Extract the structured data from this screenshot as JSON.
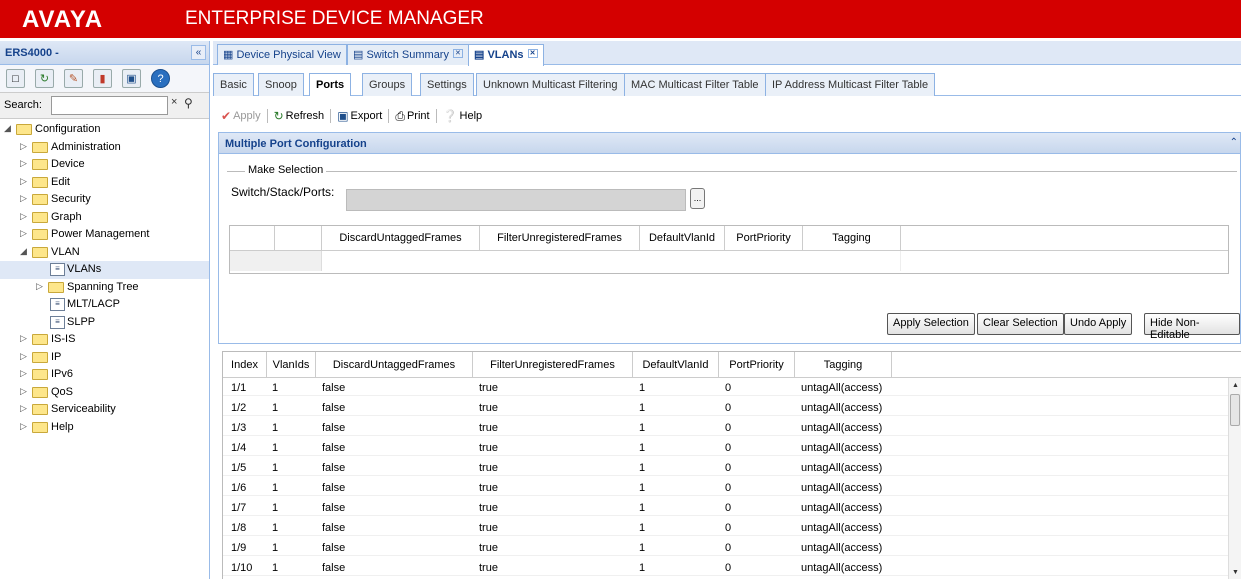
{
  "header": {
    "logo": "AVAYA",
    "title": "ENTERPRISE DEVICE MANAGER"
  },
  "sidebar": {
    "device": "ERS4000 -",
    "collapse_glyph": "«",
    "search_label": "Search:",
    "search_value": "",
    "tools": [
      "home-icon",
      "refresh-icon",
      "edit-icon",
      "graph-icon",
      "save-icon",
      "help-icon"
    ],
    "tree": [
      {
        "label": "Configuration",
        "level": 0,
        "type": "folder",
        "expanded": true
      },
      {
        "label": "Administration",
        "level": 1,
        "type": "folder"
      },
      {
        "label": "Device",
        "level": 1,
        "type": "folder"
      },
      {
        "label": "Edit",
        "level": 1,
        "type": "folder"
      },
      {
        "label": "Security",
        "level": 1,
        "type": "folder"
      },
      {
        "label": "Graph",
        "level": 1,
        "type": "folder"
      },
      {
        "label": "Power Management",
        "level": 1,
        "type": "folder"
      },
      {
        "label": "VLAN",
        "level": 1,
        "type": "folder",
        "expanded": true
      },
      {
        "label": "VLANs",
        "level": 2,
        "type": "doc",
        "selected": true
      },
      {
        "label": "Spanning Tree",
        "level": 2,
        "type": "folder"
      },
      {
        "label": "MLT/LACP",
        "level": 2,
        "type": "doc"
      },
      {
        "label": "SLPP",
        "level": 2,
        "type": "doc"
      },
      {
        "label": "IS-IS",
        "level": 1,
        "type": "folder"
      },
      {
        "label": "IP",
        "level": 1,
        "type": "folder"
      },
      {
        "label": "IPv6",
        "level": 1,
        "type": "folder"
      },
      {
        "label": "QoS",
        "level": 1,
        "type": "folder"
      },
      {
        "label": "Serviceability",
        "level": 1,
        "type": "folder"
      },
      {
        "label": "Help",
        "level": 1,
        "type": "folder"
      }
    ]
  },
  "tabs": [
    {
      "label": "Device Physical View"
    },
    {
      "label": "Switch Summary"
    },
    {
      "label": "VLANs"
    }
  ],
  "subtabs": [
    "Basic",
    "Snoop",
    "Ports",
    "Groups",
    "Settings",
    "Unknown Multicast Filtering",
    "MAC Multicast Filter Table",
    "IP Address Multicast Filter Table"
  ],
  "toolbar": {
    "apply": "Apply",
    "refresh": "Refresh",
    "export": "Export",
    "print": "Print",
    "help": "Help"
  },
  "mpc": {
    "title": "Multiple Port Configuration",
    "legend": "Make Selection",
    "ssp_label": "Switch/Stack/Ports:",
    "ssp_btn": "...",
    "columns": [
      "DiscardUntaggedFrames",
      "FilterUnregisteredFrames",
      "DefaultVlanId",
      "PortPriority",
      "Tagging"
    ],
    "buttons": {
      "apply_selection": "Apply Selection",
      "clear_selection": "Clear Selection",
      "undo_apply": "Undo Apply",
      "hide_non_editable": "Hide Non-Editable"
    }
  },
  "grid": {
    "columns": [
      "Index",
      "VlanIds",
      "DiscardUntaggedFrames",
      "FilterUnregisteredFrames",
      "DefaultVlanId",
      "PortPriority",
      "Tagging"
    ],
    "rows": [
      [
        "1/1",
        "1",
        "false",
        "true",
        "1",
        "0",
        "untagAll(access)"
      ],
      [
        "1/2",
        "1",
        "false",
        "true",
        "1",
        "0",
        "untagAll(access)"
      ],
      [
        "1/3",
        "1",
        "false",
        "true",
        "1",
        "0",
        "untagAll(access)"
      ],
      [
        "1/4",
        "1",
        "false",
        "true",
        "1",
        "0",
        "untagAll(access)"
      ],
      [
        "1/5",
        "1",
        "false",
        "true",
        "1",
        "0",
        "untagAll(access)"
      ],
      [
        "1/6",
        "1",
        "false",
        "true",
        "1",
        "0",
        "untagAll(access)"
      ],
      [
        "1/7",
        "1",
        "false",
        "true",
        "1",
        "0",
        "untagAll(access)"
      ],
      [
        "1/8",
        "1",
        "false",
        "true",
        "1",
        "0",
        "untagAll(access)"
      ],
      [
        "1/9",
        "1",
        "false",
        "true",
        "1",
        "0",
        "untagAll(access)"
      ],
      [
        "1/10",
        "1",
        "false",
        "true",
        "1",
        "0",
        "untagAll(access)"
      ]
    ]
  }
}
